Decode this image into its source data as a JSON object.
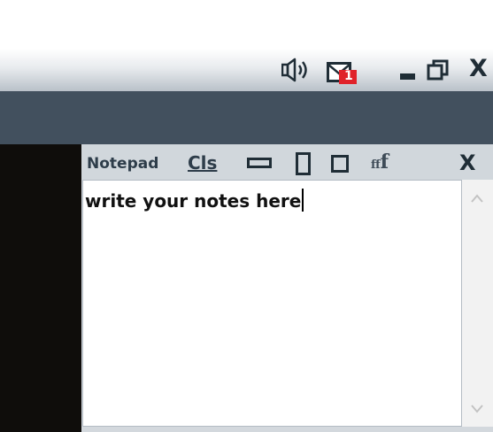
{
  "window_controls": {
    "sound_icon": "speaker-icon",
    "mail_icon": "mail-icon",
    "mail_badge": "1",
    "minimize_icon": "minimize-icon",
    "restore_icon": "restore-icon",
    "close_label": "X"
  },
  "notepad": {
    "title": "Notepad",
    "clear_label": "Cls",
    "wide_icon": "wide-layout-icon",
    "tall_icon": "tall-layout-icon",
    "square_icon": "square-layout-icon",
    "font_small": "f",
    "font_large": "f",
    "close_label": "X",
    "content": "write your notes here"
  },
  "colors": {
    "dark_band": "#42505e",
    "left_panel": "#0f0d0b",
    "toolbar": "#d1d7dc",
    "accent_text": "#2e3d4a",
    "badge_red": "#e0222a"
  }
}
